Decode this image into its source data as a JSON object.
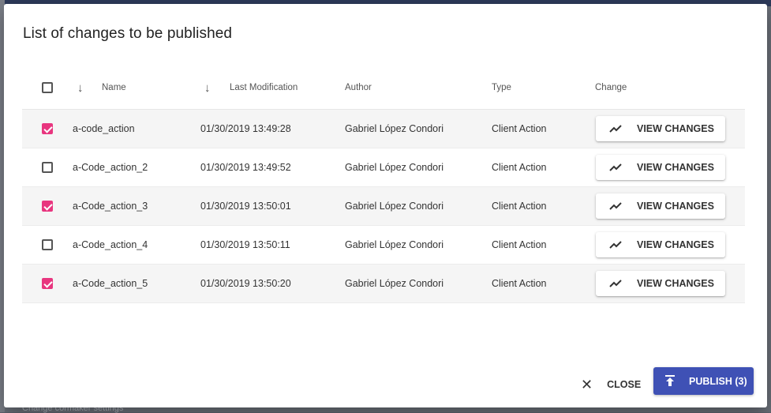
{
  "background": {
    "bottom_text": "Change cormaker settings"
  },
  "dialog": {
    "title": "List of changes to be published",
    "columns": {
      "name": "Name",
      "last_modification": "Last Modification",
      "author": "Author",
      "type": "Type",
      "change": "Change"
    },
    "rows": [
      {
        "selected": true,
        "name": "a-code_action",
        "modified": "01/30/2019 13:49:28",
        "author": "Gabriel López Condori",
        "type": "Client Action",
        "action": "VIEW CHANGES"
      },
      {
        "selected": false,
        "name": "a-Code_action_2",
        "modified": "01/30/2019 13:49:52",
        "author": "Gabriel López Condori",
        "type": "Client Action",
        "action": "VIEW CHANGES"
      },
      {
        "selected": true,
        "name": "a-Code_action_3",
        "modified": "01/30/2019 13:50:01",
        "author": "Gabriel López Condori",
        "type": "Client Action",
        "action": "VIEW CHANGES"
      },
      {
        "selected": false,
        "name": "a-Code_action_4",
        "modified": "01/30/2019 13:50:11",
        "author": "Gabriel López Condori",
        "type": "Client Action",
        "action": "VIEW CHANGES"
      },
      {
        "selected": true,
        "name": "a-Code_action_5",
        "modified": "01/30/2019 13:50:20",
        "author": "Gabriel López Condori",
        "type": "Client Action",
        "action": "VIEW CHANGES"
      }
    ],
    "footer": {
      "close_label": "CLOSE",
      "publish_label": "PUBLISH (3)"
    }
  },
  "colors": {
    "accent": "#3f51b5",
    "checkbox": "#e8367f"
  },
  "icons": {
    "sort": "arrow-down-icon",
    "view_changes": "trending-icon",
    "close": "close-icon",
    "publish": "publish-icon"
  }
}
